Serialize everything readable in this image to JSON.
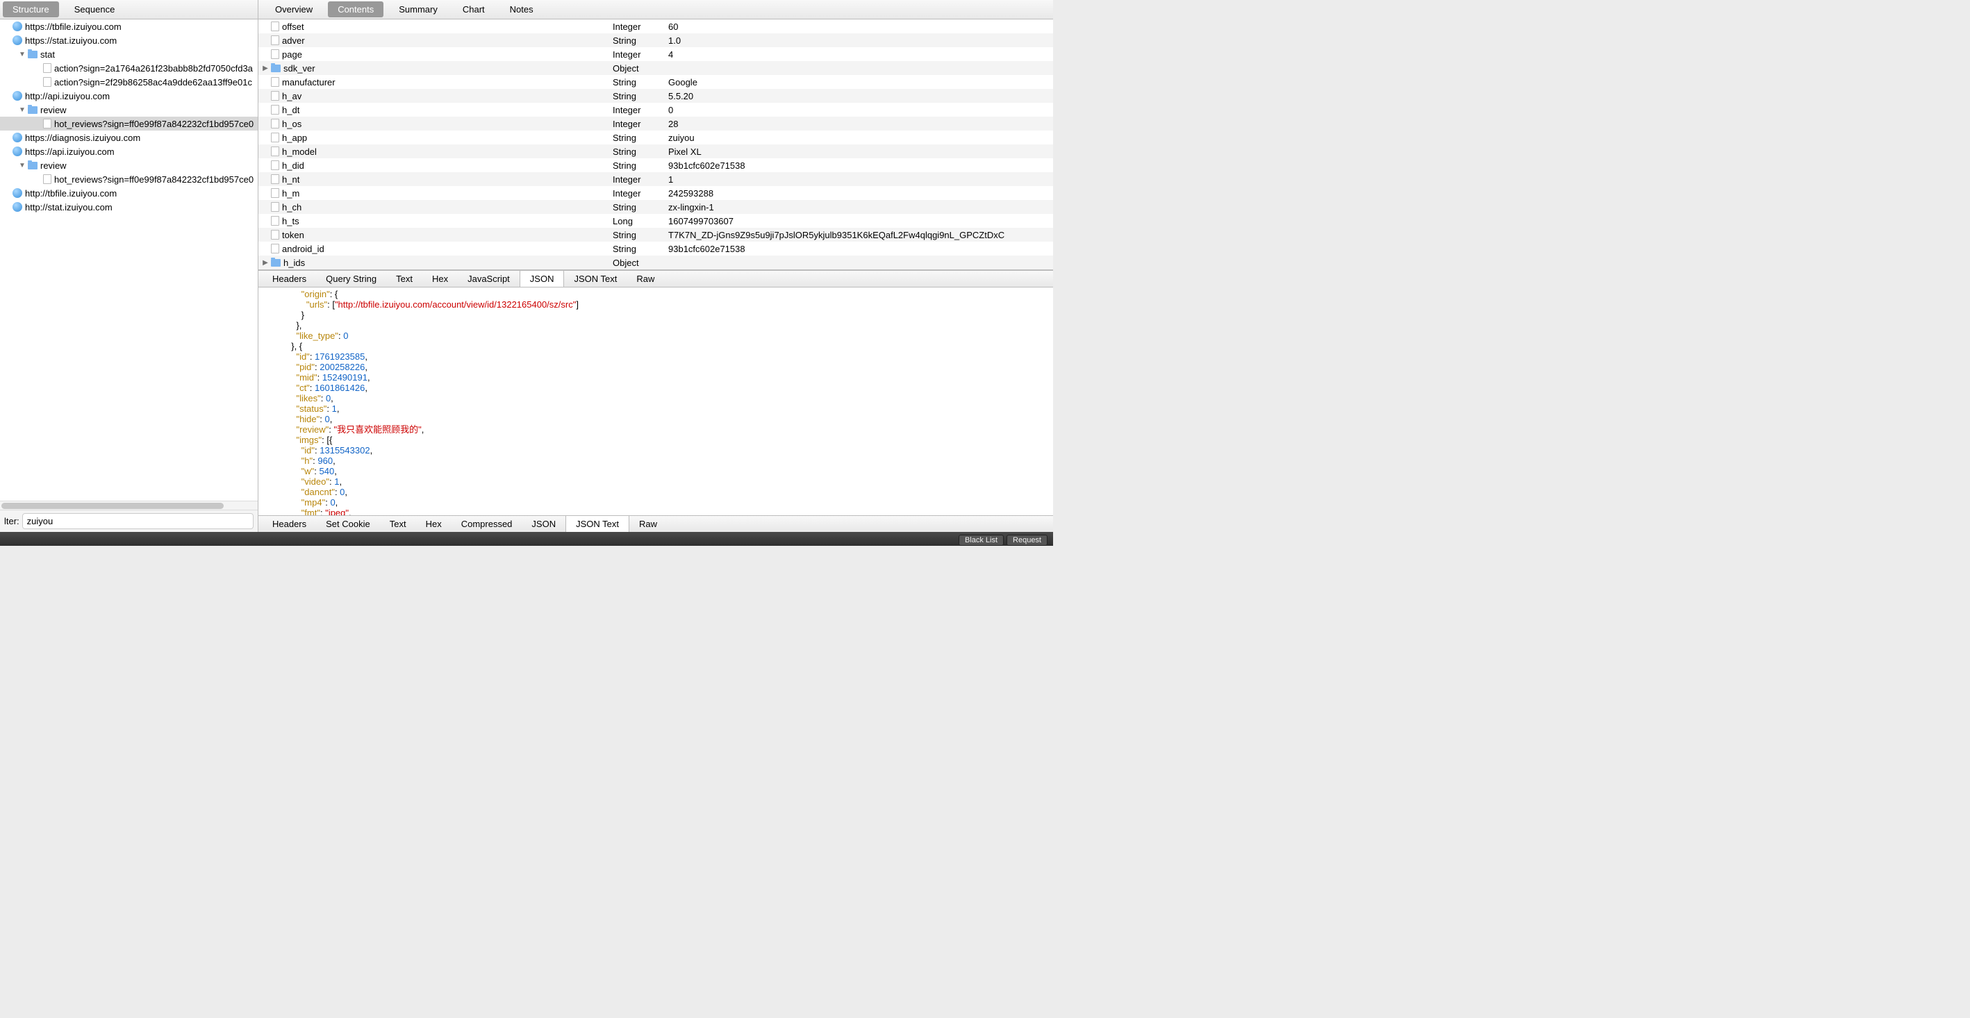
{
  "leftTabs": [
    "Structure",
    "Sequence"
  ],
  "leftActive": 0,
  "tree": [
    {
      "d": 0,
      "k": "globe",
      "t": "",
      "label": "https://tbfile.izuiyou.com"
    },
    {
      "d": 0,
      "k": "globe",
      "t": "",
      "label": "https://stat.izuiyou.com"
    },
    {
      "d": 1,
      "k": "folder",
      "t": "▼",
      "label": "stat"
    },
    {
      "d": 2,
      "k": "file",
      "t": "",
      "label": "action?sign=2a1764a261f23babb8b2fd7050cfd3a"
    },
    {
      "d": 2,
      "k": "file",
      "t": "",
      "label": "action?sign=2f29b86258ac4a9dde62aa13ff9e01c"
    },
    {
      "d": 0,
      "k": "globe",
      "t": "",
      "label": "http://api.izuiyou.com"
    },
    {
      "d": 1,
      "k": "folder",
      "t": "▼",
      "label": "review"
    },
    {
      "d": 2,
      "k": "file",
      "t": "",
      "label": "hot_reviews?sign=ff0e99f87a842232cf1bd957ce0",
      "sel": true
    },
    {
      "d": 0,
      "k": "globe",
      "t": "",
      "label": "https://diagnosis.izuiyou.com"
    },
    {
      "d": 0,
      "k": "globe",
      "t": "",
      "label": "https://api.izuiyou.com"
    },
    {
      "d": 1,
      "k": "folder",
      "t": "▼",
      "label": "review"
    },
    {
      "d": 2,
      "k": "file",
      "t": "",
      "label": "hot_reviews?sign=ff0e99f87a842232cf1bd957ce0"
    },
    {
      "d": 0,
      "k": "globe",
      "t": "",
      "label": "http://tbfile.izuiyou.com"
    },
    {
      "d": 0,
      "k": "globe",
      "t": "",
      "label": "http://stat.izuiyou.com"
    }
  ],
  "filterLabel": "lter:",
  "filterValue": "zuiyou",
  "rightTabs": [
    "Overview",
    "Contents",
    "Summary",
    "Chart",
    "Notes"
  ],
  "rightActive": 1,
  "rows": [
    {
      "tw": "",
      "k": "offset",
      "t": "Integer",
      "v": "60"
    },
    {
      "tw": "",
      "k": "adver",
      "t": "String",
      "v": "1.0"
    },
    {
      "tw": "",
      "k": "page",
      "t": "Integer",
      "v": "4"
    },
    {
      "tw": "▶",
      "icon": "folder",
      "k": "sdk_ver",
      "t": "Object",
      "v": ""
    },
    {
      "tw": "",
      "k": "manufacturer",
      "t": "String",
      "v": "Google"
    },
    {
      "tw": "",
      "k": "h_av",
      "t": "String",
      "v": "5.5.20"
    },
    {
      "tw": "",
      "k": "h_dt",
      "t": "Integer",
      "v": "0"
    },
    {
      "tw": "",
      "k": "h_os",
      "t": "Integer",
      "v": "28"
    },
    {
      "tw": "",
      "k": "h_app",
      "t": "String",
      "v": "zuiyou"
    },
    {
      "tw": "",
      "k": "h_model",
      "t": "String",
      "v": "Pixel XL"
    },
    {
      "tw": "",
      "k": "h_did",
      "t": "String",
      "v": "93b1cfc602e71538"
    },
    {
      "tw": "",
      "k": "h_nt",
      "t": "Integer",
      "v": "1"
    },
    {
      "tw": "",
      "k": "h_m",
      "t": "Integer",
      "v": "242593288"
    },
    {
      "tw": "",
      "k": "h_ch",
      "t": "String",
      "v": "zx-lingxin-1"
    },
    {
      "tw": "",
      "k": "h_ts",
      "t": "Long",
      "v": "1607499703607"
    },
    {
      "tw": "",
      "k": "token",
      "t": "String",
      "v": "T7K7N_ZD-jGns9Z9s5u9ji7pJslOR5ykjulb9351K6kEQafL2Fw4qlqgi9nL_GPCZtDxC"
    },
    {
      "tw": "",
      "k": "android_id",
      "t": "String",
      "v": "93b1cfc602e71538"
    },
    {
      "tw": "▶",
      "icon": "folder",
      "k": "h_ids",
      "t": "Object",
      "v": ""
    }
  ],
  "subTabs": [
    "Headers",
    "Query String",
    "Text",
    "Hex",
    "JavaScript",
    "JSON",
    "JSON Text",
    "Raw"
  ],
  "subActive": 5,
  "jsonLines": [
    [
      [
        "      ",
        ""
      ],
      [
        "\"origin\"",
        "k"
      ],
      [
        ": {",
        "p"
      ]
    ],
    [
      [
        "        ",
        ""
      ],
      [
        "\"urls\"",
        "k"
      ],
      [
        ": [",
        "p"
      ],
      [
        "\"http://tbfile.izuiyou.com/account/view/id/1322165400/sz/src\"",
        "s"
      ],
      [
        "]",
        "p"
      ]
    ],
    [
      [
        "      }",
        ""
      ]
    ],
    [
      [
        "    },",
        ""
      ]
    ],
    [
      [
        "    ",
        ""
      ],
      [
        "\"like_type\"",
        "k"
      ],
      [
        ": ",
        "p"
      ],
      [
        "0",
        "n"
      ]
    ],
    [
      [
        "  }, {",
        ""
      ]
    ],
    [
      [
        "    ",
        ""
      ],
      [
        "\"id\"",
        "k"
      ],
      [
        ": ",
        "p"
      ],
      [
        "1761923585",
        "n"
      ],
      [
        ",",
        "p"
      ]
    ],
    [
      [
        "    ",
        ""
      ],
      [
        "\"pid\"",
        "k"
      ],
      [
        ": ",
        "p"
      ],
      [
        "200258226",
        "n"
      ],
      [
        ",",
        "p"
      ]
    ],
    [
      [
        "    ",
        ""
      ],
      [
        "\"mid\"",
        "k"
      ],
      [
        ": ",
        "p"
      ],
      [
        "152490191",
        "n"
      ],
      [
        ",",
        "p"
      ]
    ],
    [
      [
        "    ",
        ""
      ],
      [
        "\"ct\"",
        "k"
      ],
      [
        ": ",
        "p"
      ],
      [
        "1601861426",
        "n"
      ],
      [
        ",",
        "p"
      ]
    ],
    [
      [
        "    ",
        ""
      ],
      [
        "\"likes\"",
        "k"
      ],
      [
        ": ",
        "p"
      ],
      [
        "0",
        "n"
      ],
      [
        ",",
        "p"
      ]
    ],
    [
      [
        "    ",
        ""
      ],
      [
        "\"status\"",
        "k"
      ],
      [
        ": ",
        "p"
      ],
      [
        "1",
        "n"
      ],
      [
        ",",
        "p"
      ]
    ],
    [
      [
        "    ",
        ""
      ],
      [
        "\"hide\"",
        "k"
      ],
      [
        ": ",
        "p"
      ],
      [
        "0",
        "n"
      ],
      [
        ",",
        "p"
      ]
    ],
    [
      [
        "    ",
        ""
      ],
      [
        "\"review\"",
        "k"
      ],
      [
        ": ",
        "p"
      ],
      [
        "\"我只喜欢能照顾我的\"",
        "s"
      ],
      [
        ",",
        "p"
      ]
    ],
    [
      [
        "    ",
        ""
      ],
      [
        "\"imgs\"",
        "k"
      ],
      [
        ": [{",
        "p"
      ]
    ],
    [
      [
        "      ",
        ""
      ],
      [
        "\"id\"",
        "k"
      ],
      [
        ": ",
        "p"
      ],
      [
        "1315543302",
        "n"
      ],
      [
        ",",
        "p"
      ]
    ],
    [
      [
        "      ",
        ""
      ],
      [
        "\"h\"",
        "k"
      ],
      [
        ": ",
        "p"
      ],
      [
        "960",
        "n"
      ],
      [
        ",",
        "p"
      ]
    ],
    [
      [
        "      ",
        ""
      ],
      [
        "\"w\"",
        "k"
      ],
      [
        ": ",
        "p"
      ],
      [
        "540",
        "n"
      ],
      [
        ",",
        "p"
      ]
    ],
    [
      [
        "      ",
        ""
      ],
      [
        "\"video\"",
        "k"
      ],
      [
        ": ",
        "p"
      ],
      [
        "1",
        "n"
      ],
      [
        ",",
        "p"
      ]
    ],
    [
      [
        "      ",
        ""
      ],
      [
        "\"dancnt\"",
        "k"
      ],
      [
        ": ",
        "p"
      ],
      [
        "0",
        "n"
      ],
      [
        ",",
        "p"
      ]
    ],
    [
      [
        "      ",
        ""
      ],
      [
        "\"mp4\"",
        "k"
      ],
      [
        ": ",
        "p"
      ],
      [
        "0",
        "n"
      ],
      [
        ",",
        "p"
      ]
    ],
    [
      [
        "      ",
        ""
      ],
      [
        "\"fmt\"",
        "k"
      ],
      [
        ": ",
        "p"
      ],
      [
        "\"jpeg\"",
        "s"
      ],
      [
        ",",
        "p"
      ]
    ]
  ],
  "bottomTabs": [
    "Headers",
    "Set Cookie",
    "Text",
    "Hex",
    "Compressed",
    "JSON",
    "JSON Text",
    "Raw"
  ],
  "bottomActive": 6,
  "statusButtons": [
    "Black List",
    "Request"
  ]
}
